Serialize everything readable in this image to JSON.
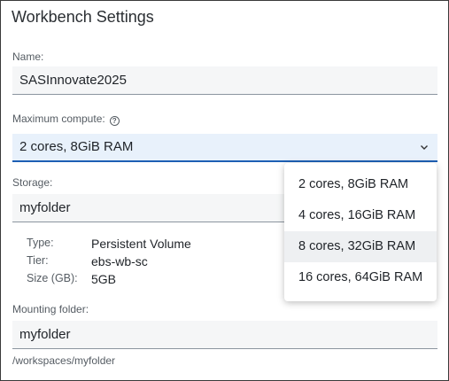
{
  "title": "Workbench Settings",
  "name": {
    "label": "Name:",
    "value": "SASInnovate2025"
  },
  "compute": {
    "label": "Maximum compute:",
    "value": "2 cores, 8GiB RAM",
    "options": [
      "2 cores, 8GiB RAM",
      "4 cores, 16GiB RAM",
      "8 cores, 32GiB RAM",
      "16 cores, 64GiB RAM"
    ]
  },
  "storage": {
    "label": "Storage:",
    "value": "myfolder",
    "details": [
      {
        "key": "Type:",
        "value": "Persistent Volume"
      },
      {
        "key": "Tier:",
        "value": "ebs-wb-sc"
      },
      {
        "key": "Size (GB):",
        "value": "5GB"
      }
    ]
  },
  "mounting": {
    "label": "Mounting folder:",
    "value": "myfolder",
    "hint": "/workspaces/myfolder"
  }
}
